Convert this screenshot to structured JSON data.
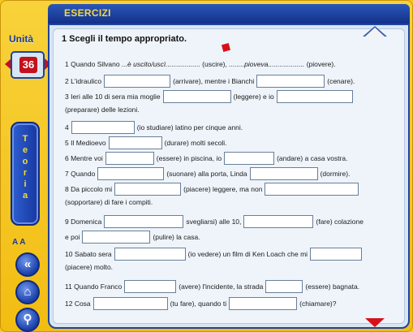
{
  "header": {
    "title": "ESERCIZI"
  },
  "sidebar": {
    "unita_label": "Unità",
    "unit_number": "36",
    "teoria_letters": [
      "T",
      "e",
      "o",
      "r",
      "i",
      "a"
    ],
    "font_toggle": "A A"
  },
  "exercise": {
    "title": "1 Scegli il tempo appropriato.",
    "lines": [
      {
        "a": "1  Quando Silvano",
        "b": "...è uscito/uscì..................",
        "c": "(uscire),",
        "d": "........pioveva...................",
        "e": "(piovere)."
      },
      {
        "a": "2  L'idraulico",
        "b": "(arrivare), mentre i Bianchi",
        "c": "(cenare)."
      },
      {
        "a": "3  Ieri alle 10 di sera mia moglie",
        "b": "(leggere) e  io"
      },
      {
        "a": "(preparare) delle lezioni."
      },
      {
        "a": "4",
        "b": "(io studiare) latino per cinque anni."
      },
      {
        "a": "5  Il Medioevo",
        "b": "(durare) molti secoli."
      },
      {
        "a": "6  Mentre voi",
        "b": "(essere) in piscina, io",
        "c": "(andare) a casa vostra."
      },
      {
        "a": "7  Quando",
        "b": "(suonare) alla porta, Linda",
        "c": "(dormire)."
      },
      {
        "a": "8  Da piccolo mi",
        "b": "(piacere) leggere, ma non"
      },
      {
        "a": "(sopportare) di fare i compiti."
      },
      {
        "a": "9  Domenica",
        "b": "svegliarsi) alle 10,",
        "c": "(fare) colazione"
      },
      {
        "a": "e poi",
        "b": "(pulire) la casa."
      },
      {
        "a": "10 Sabato sera",
        "b": "(io vedere) un film di Ken  Loach che mi"
      },
      {
        "a": "(piacere) molto."
      },
      {
        "a": "11 Quando Franco",
        "b": "(avere) l'incidente, la  strada",
        "c": "(essere) bagnata."
      },
      {
        "a": "12 Cosa",
        "b": "(tu fare), quando ti",
        "c": "(chiamare)?"
      }
    ]
  },
  "colors": {
    "frame": "#f2bd12",
    "accent": "#1e43a0",
    "red": "#c4101a"
  },
  "icons": {
    "back": "double-chevron-left-icon",
    "home": "home-icon",
    "search": "magnifier-icon"
  }
}
